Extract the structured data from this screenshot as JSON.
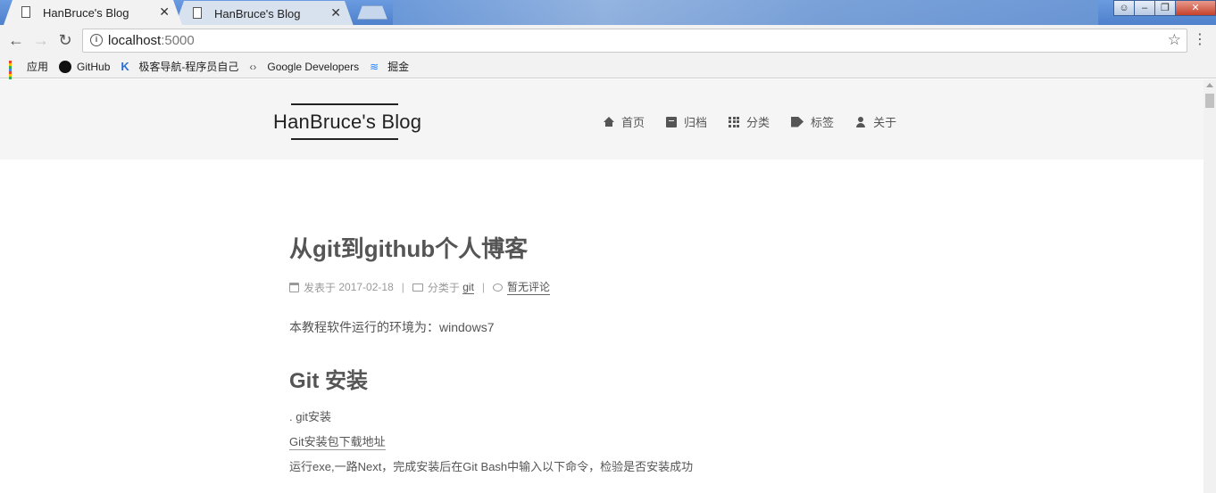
{
  "browser": {
    "tabs": [
      {
        "title": "HanBruce's Blog",
        "active": true
      },
      {
        "title": "HanBruce's Blog",
        "active": false
      }
    ],
    "address": {
      "host": "localhost",
      "port": ":5000"
    },
    "bookmarks": [
      {
        "label": "应用",
        "icon": "apps-icon"
      },
      {
        "label": "GitHub",
        "icon": "github-icon"
      },
      {
        "label": "极客导航-程序员自己",
        "icon": "jk-icon"
      },
      {
        "label": "Google Developers",
        "icon": "google-developers-icon"
      },
      {
        "label": "掘金",
        "icon": "juejin-icon"
      }
    ]
  },
  "site": {
    "brand": "HanBruce's Blog",
    "nav": [
      {
        "label": "首页",
        "icon": "home-icon"
      },
      {
        "label": "归档",
        "icon": "archive-icon"
      },
      {
        "label": "分类",
        "icon": "th-icon"
      },
      {
        "label": "标签",
        "icon": "tags-icon"
      },
      {
        "label": "关于",
        "icon": "user-icon"
      }
    ]
  },
  "post": {
    "title": "从git到github个人博客",
    "meta": {
      "posted_prefix": "发表于",
      "date": "2017-02-18",
      "category_prefix": "分类于",
      "category": "git",
      "comments": "暂无评论"
    },
    "intro": "本教程软件运行的环境为：windows7",
    "heading": "Git 安装",
    "lines": [
      ". git安装",
      "Git安装包下载地址",
      "运行exe,一路Next，完成安装后在Git Bash中输入以下命令，检验是否安装成功"
    ]
  }
}
